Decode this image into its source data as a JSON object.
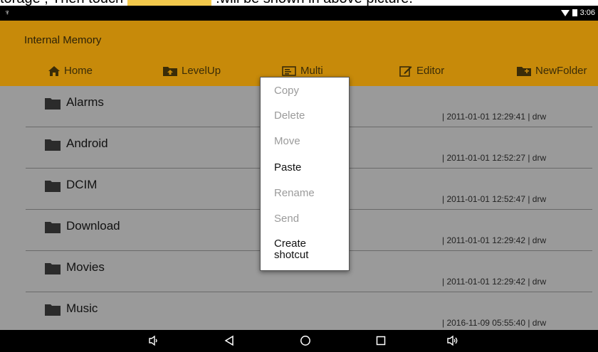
{
  "caption": {
    "before": "torage ; Then touch",
    "after": ".will be shown in above picture."
  },
  "status_bar": {
    "usb_glyph": "♆",
    "time": "3:06"
  },
  "header": {
    "title": "Internal Memory",
    "toolbar": [
      {
        "label": "Home",
        "icon": "home-icon"
      },
      {
        "label": "LevelUp",
        "icon": "folder-up-icon"
      },
      {
        "label": "Multi",
        "icon": "multi-select-icon"
      },
      {
        "label": "Editor",
        "icon": "edit-icon"
      },
      {
        "label": "NewFolder",
        "icon": "new-folder-icon"
      }
    ]
  },
  "files": [
    {
      "name": "Alarms",
      "meta": "| 2011-01-01 12:29:41 | drw"
    },
    {
      "name": "Android",
      "meta": "| 2011-01-01 12:52:27 | drw"
    },
    {
      "name": "DCIM",
      "meta": "| 2011-01-01 12:52:47 | drw"
    },
    {
      "name": "Download",
      "meta": "| 2011-01-01 12:29:42 | drw"
    },
    {
      "name": "Movies",
      "meta": "| 2011-01-01 12:29:42 | drw"
    },
    {
      "name": "Music",
      "meta": "| 2016-11-09 05:55:40 | drw"
    }
  ],
  "context_menu": [
    {
      "label": "Copy",
      "enabled": false
    },
    {
      "label": "Delete",
      "enabled": false
    },
    {
      "label": "Move",
      "enabled": false
    },
    {
      "label": "Paste",
      "enabled": true
    },
    {
      "label": "Rename",
      "enabled": false
    },
    {
      "label": "Send",
      "enabled": false
    },
    {
      "label": "Create shotcut",
      "enabled": true
    }
  ],
  "nav_bar": [
    {
      "icon": "volume-down-icon"
    },
    {
      "icon": "back-icon"
    },
    {
      "icon": "home-circle-icon"
    },
    {
      "icon": "recents-icon"
    },
    {
      "icon": "volume-up-icon"
    }
  ],
  "colors": {
    "header": "#c78a0a",
    "list_dimmed": "#9a9a9a",
    "menu_enabled": "#111111",
    "menu_disabled": "#9b9b9b"
  }
}
